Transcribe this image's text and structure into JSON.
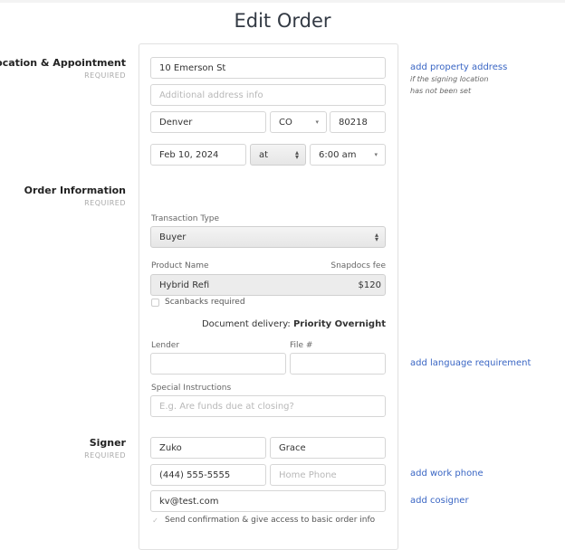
{
  "page": {
    "title": "Edit Order"
  },
  "sections": {
    "location": {
      "title": "Location & Appointment",
      "required": "REQUIRED"
    },
    "order": {
      "title": "Order Information",
      "required": "REQUIRED"
    },
    "signer": {
      "title": "Signer",
      "required": "REQUIRED"
    }
  },
  "location": {
    "address1": "10 Emerson St",
    "address2_placeholder": "Additional address info",
    "city": "Denver",
    "state": "CO",
    "zip": "80218",
    "date": "Feb 10, 2024",
    "at": "at",
    "time": "6:00 am"
  },
  "order": {
    "transaction_type_label": "Transaction Type",
    "transaction_type": "Buyer",
    "product_name_label": "Product Name",
    "fee_label": "Snapdocs fee",
    "product_name": "Hybrid Refi",
    "fee": "$120",
    "scanbacks_label": "Scanbacks required",
    "scanbacks_checked": false,
    "delivery_prefix": "Document delivery: ",
    "delivery_value": "Priority Overnight",
    "lender_label": "Lender",
    "lender": "",
    "file_label": "File #",
    "file": "",
    "instructions_label": "Special Instructions",
    "instructions_placeholder": "E.g. Are funds due at closing?"
  },
  "signer": {
    "first_name": "Zuko",
    "last_name": "Grace",
    "phone": "(444) 555-5555",
    "home_phone_placeholder": "Home Phone",
    "email": "kv@test.com",
    "confirmation_label": "Send confirmation & give access to basic order info",
    "confirmation_checked": true
  },
  "links": {
    "add_property_address": "add property address",
    "property_hint_line1": "if the signing location",
    "property_hint_line2": "has not been set",
    "add_language": "add language requirement",
    "add_work_phone": "add work phone",
    "add_cosigner": "add cosigner"
  },
  "icons": {
    "caret": "▾",
    "updown_up": "▴",
    "updown_down": "▾",
    "check": "✓"
  }
}
